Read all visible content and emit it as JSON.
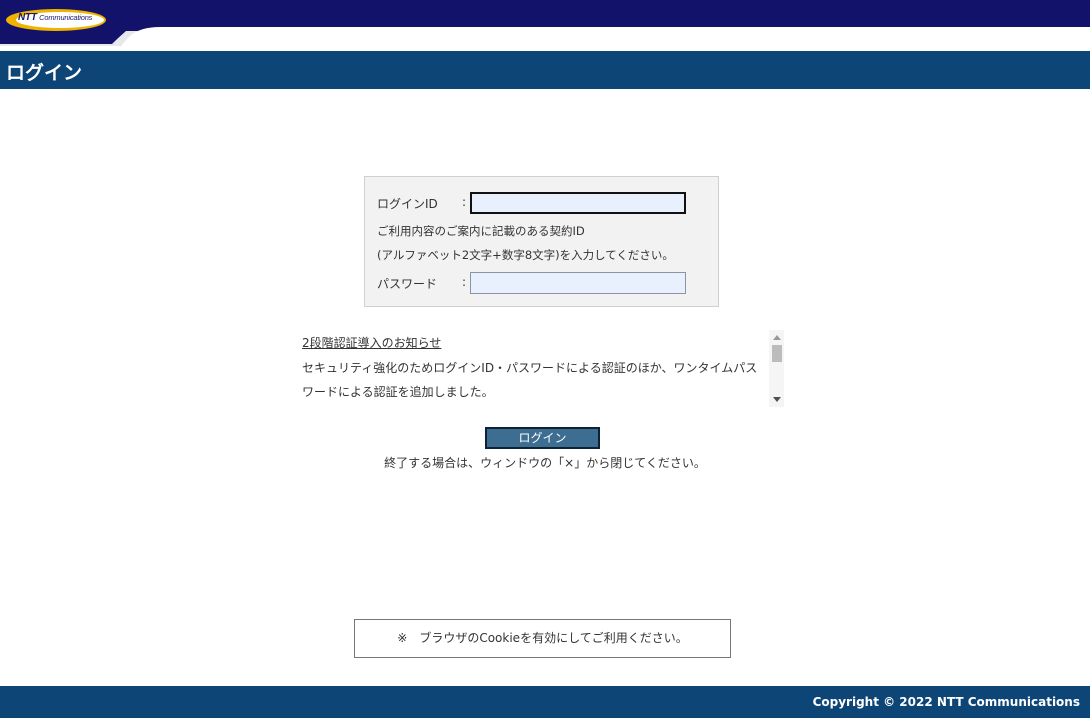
{
  "brand": {
    "logo_ntt": "NTT",
    "logo_comm": "Communications",
    "colors": {
      "navy": "#12126a",
      "gold": "#f0b400",
      "band": "#0e4577"
    }
  },
  "header": {
    "title": "ログイン"
  },
  "form": {
    "id_label": "ログインID",
    "colon": ":",
    "id_value": "",
    "help_line1": "ご利用内容のご案内に記載のある契約ID",
    "help_line2": "(アルファベット2文字+数字8文字)を入力してください。",
    "password_label": "パスワード",
    "password_value": ""
  },
  "notice": {
    "link_text": "2段階認証導入のお知らせ",
    "body": "セキュリティ強化のためログインID・パスワードによる認証のほか、ワンタイムパスワードによる認証を追加しました。"
  },
  "actions": {
    "login_button": "ログイン",
    "exit_note": "終了する場合は、ウィンドウの「×」から閉じてください。"
  },
  "cookie_note": "※　ブラウザのCookieを有効にしてご利用ください。",
  "footer": {
    "copyright": "Copyright © 2022 NTT Communications"
  }
}
